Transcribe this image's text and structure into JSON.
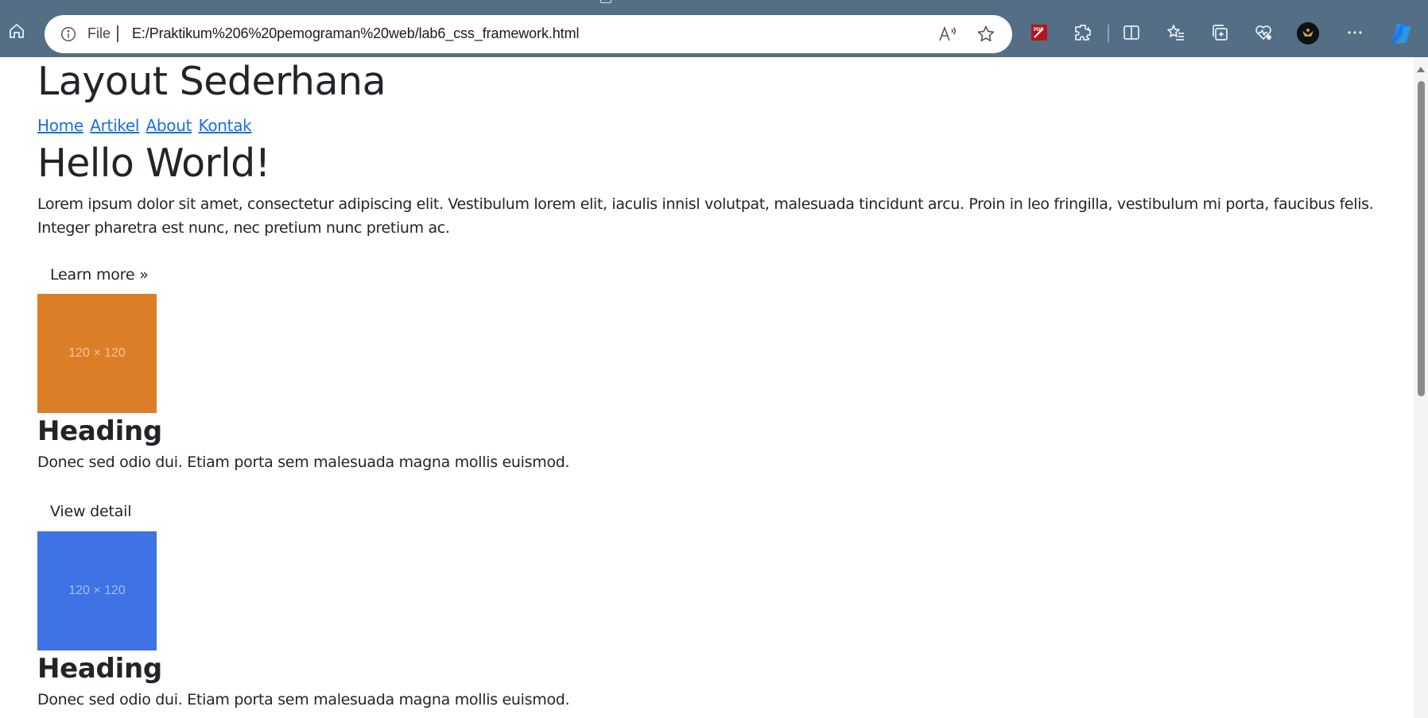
{
  "browser": {
    "file_label": "File",
    "url": "E:/Praktikum%206%20pemograman%20web/lab6_css_framework.html",
    "chrome_color": "#546e86"
  },
  "page": {
    "site_title": "Layout Sederhana",
    "nav": [
      "Home",
      "Artikel",
      "About",
      "Kontak"
    ],
    "hero": {
      "title": "Hello World!",
      "lead": "Lorem ipsum dolor sit amet, consectetur adipiscing elit. Vestibulum lorem elit, iaculis innisl volutpat, malesuada tincidunt arcu. Proin in leo fringilla, vestibulum mi porta, faucibus felis. Integer pharetra est nunc, nec pretium nunc pretium ac.",
      "button": "Learn more »"
    },
    "cards": [
      {
        "image_label": "120 × 120",
        "image_color": "#dc7e28",
        "image_text_color": "#f6dcc2",
        "heading": "Heading",
        "text": "Donec sed odio dui. Etiam porta sem malesuada magna mollis euismod.",
        "button": "View detail"
      },
      {
        "image_label": "120 × 120",
        "image_color": "#3f72e4",
        "image_text_color": "#c6d4f5",
        "heading": "Heading",
        "text": "Donec sed odio dui. Etiam porta sem malesuada magna mollis euismod."
      }
    ]
  }
}
